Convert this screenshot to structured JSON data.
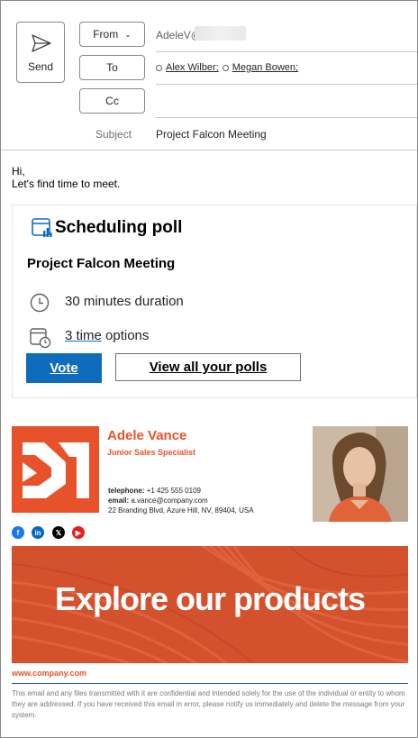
{
  "compose": {
    "send_label": "Send",
    "from_label": "From",
    "to_label": "To",
    "cc_label": "Cc",
    "from_value": "AdeleV@",
    "recipients": [
      "Alex Wilber;",
      "Megan Bowen;"
    ],
    "subject_label": "Subject",
    "subject_value": "Project Falcon Meeting"
  },
  "body": {
    "greeting": "Hi,",
    "message": "Let's find time to meet."
  },
  "poll": {
    "title": "Scheduling poll",
    "meeting_name": "Project Falcon Meeting",
    "duration": "30 minutes duration",
    "options_count": "3 time",
    "options_suffix": " options",
    "vote_label": "Vote",
    "view_all_label": "View all your polls"
  },
  "signature": {
    "name": "Adele Vance",
    "role": "Junior Sales Specialist",
    "telephone_label": "telephone:",
    "telephone": "+1 425 555 0109",
    "email_label": "email:",
    "email": "a.vance@company.com",
    "address": "22 Branding Blvd, Azure Hill, NV, 89404, USA",
    "social": [
      "facebook-icon",
      "linkedin-icon",
      "x-icon",
      "youtube-icon"
    ],
    "banner_text": "Explore our products",
    "website": "www.company.com",
    "disclaimer": "This email and any files transmitted with it are confidential and intended solely for the use of the individual or entity to whom they are addressed. If you have received this email in error, please notify us immediately and delete the message from your system."
  },
  "colors": {
    "accent": "#0f6cbd",
    "brand": "#e8522a"
  }
}
